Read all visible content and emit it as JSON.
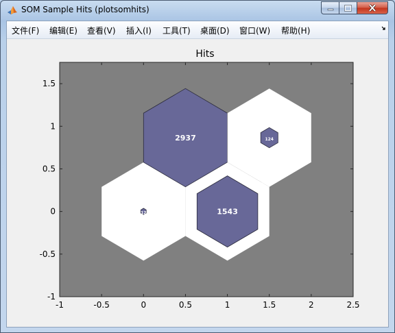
{
  "window": {
    "title": "SOM Sample Hits (plotsomhits)",
    "buttons": [
      "minimize",
      "maximize",
      "close"
    ]
  },
  "menu": {
    "items": [
      "文件(F)",
      "编辑(E)",
      "查看(V)",
      "插入(I)",
      "工具(T)",
      "桌面(D)",
      "窗口(W)",
      "帮助(H)"
    ]
  },
  "chart_data": {
    "type": "hexagonal-hits",
    "title": "Hits",
    "xlim": [
      -1,
      2.5
    ],
    "ylim": [
      -1,
      1.75
    ],
    "xticks": [
      "-1",
      "-0.5",
      "0",
      "0.5",
      "1",
      "1.5",
      "2",
      "2.5"
    ],
    "yticks": [
      "1.5",
      "1",
      "0.5",
      "0",
      "-0.5",
      "-1"
    ],
    "axes_background": "#808080",
    "hit_color": "#686898",
    "neurons": [
      {
        "x": 0,
        "y": 0,
        "hits": 12
      },
      {
        "x": 1,
        "y": 0,
        "hits": 1543
      },
      {
        "x": 0.5,
        "y": 0.866,
        "hits": 2937
      },
      {
        "x": 1.5,
        "y": 0.866,
        "hits": 124
      }
    ]
  }
}
